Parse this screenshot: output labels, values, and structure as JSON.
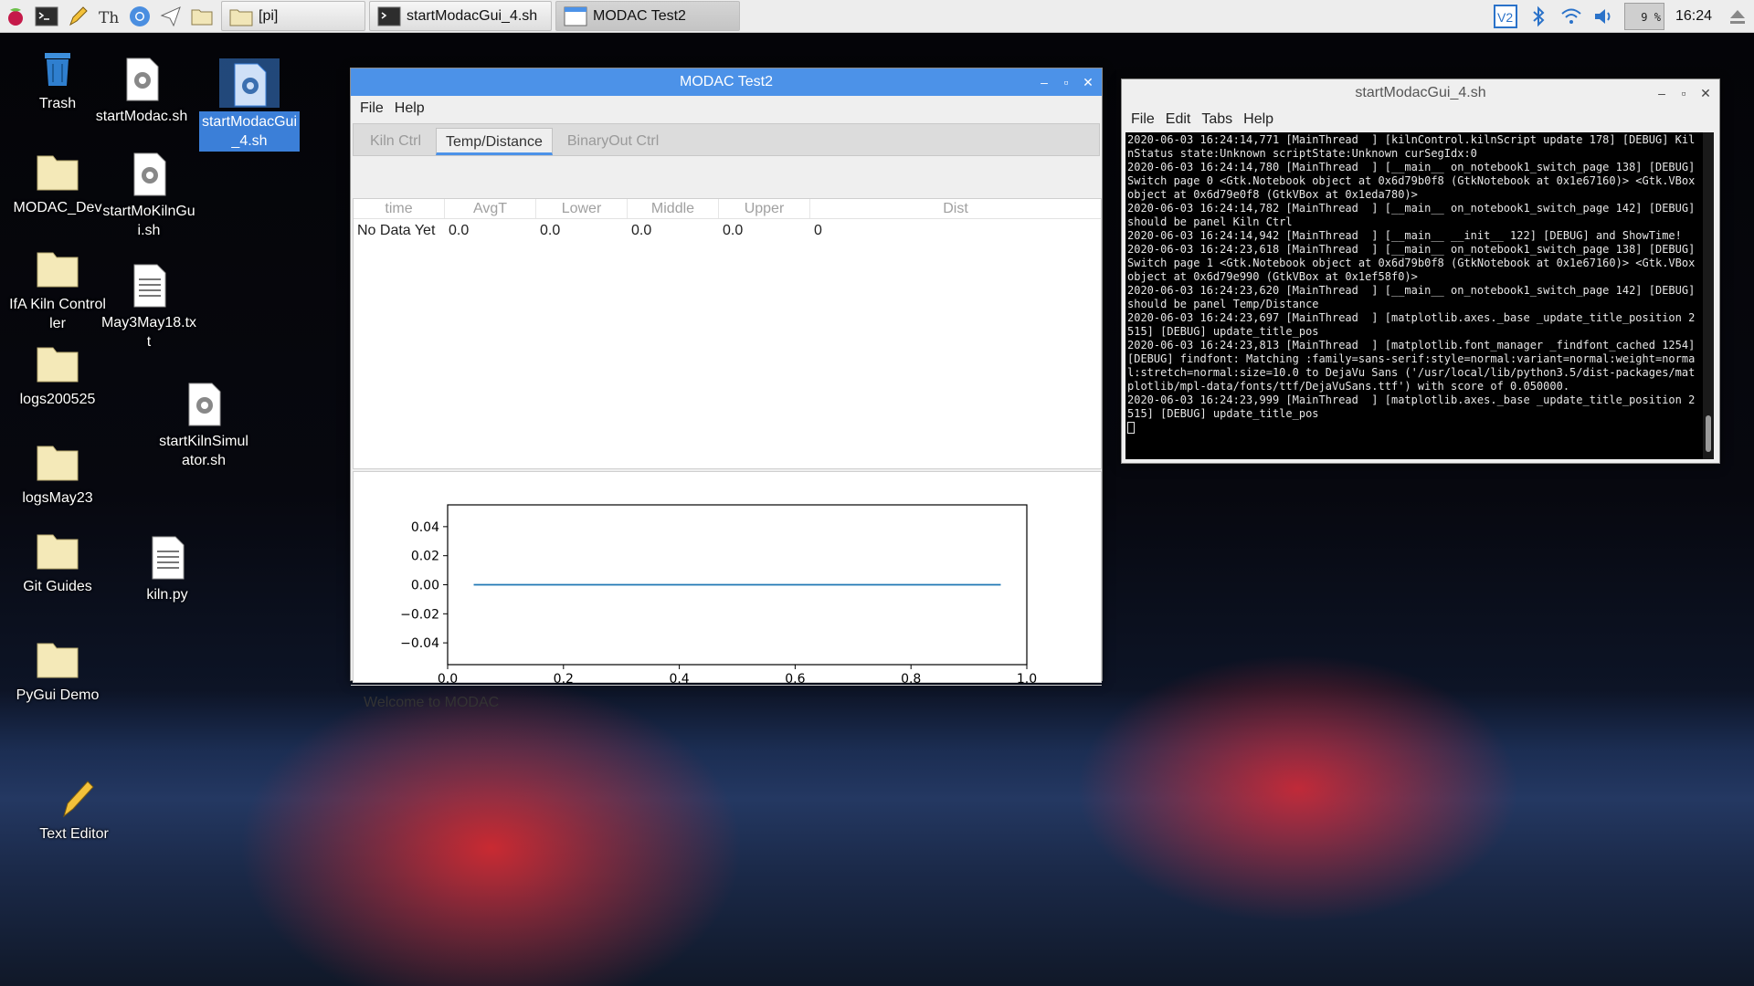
{
  "taskbar": {
    "tasks": [
      {
        "label": "[pi]"
      },
      {
        "label": "startModacGui_4.sh"
      },
      {
        "label": "MODAC Test2"
      }
    ],
    "cpu": "9 %",
    "clock": "16:24"
  },
  "desktop": {
    "icons": [
      {
        "label": "Trash"
      },
      {
        "label": "startModac.sh"
      },
      {
        "label": "startModacGui_4.sh"
      },
      {
        "label": "MODAC_Dev"
      },
      {
        "label": "startMoKilnGui.sh"
      },
      {
        "label": "IfA Kiln Controller"
      },
      {
        "label": "May3May18.txt"
      },
      {
        "label": "logs200525"
      },
      {
        "label": "startKilnSimulator.sh"
      },
      {
        "label": "logsMay23"
      },
      {
        "label": "Git Guides"
      },
      {
        "label": "kiln.py"
      },
      {
        "label": "PyGui Demo"
      },
      {
        "label": "Text Editor"
      }
    ]
  },
  "modac": {
    "title": "MODAC Test2",
    "menu": [
      "File",
      "Help"
    ],
    "tabs": [
      "Kiln Ctrl",
      "Temp/Distance",
      "BinaryOut Ctrl"
    ],
    "columns": [
      "time",
      "AvgT",
      "Lower",
      "Middle",
      "Upper",
      "Dist"
    ],
    "row": [
      "No Data Yet",
      "0.0",
      "0.0",
      "0.0",
      "0.0",
      "0"
    ],
    "status": "Welcome to MODAC"
  },
  "chart_data": {
    "type": "line",
    "title": "",
    "xlabel": "",
    "ylabel": "",
    "xlim": [
      0.0,
      1.0
    ],
    "ylim": [
      -0.055,
      0.055
    ],
    "xticks": [
      "0.0",
      "0.2",
      "0.4",
      "0.6",
      "0.8",
      "1.0"
    ],
    "yticks": [
      "0.04",
      "0.02",
      "0.00",
      "−0.02",
      "−0.04"
    ],
    "ytick_values": [
      0.04,
      0.02,
      0.0,
      -0.02,
      -0.04
    ],
    "xtick_values": [
      0.0,
      0.2,
      0.4,
      0.6,
      0.8,
      1.0
    ],
    "series": [
      {
        "x": [
          0.0,
          1.0
        ],
        "y": [
          0.0,
          0.0
        ],
        "color": "#1f77b4"
      }
    ]
  },
  "terminal": {
    "title": "startModacGui_4.sh",
    "menu": [
      "File",
      "Edit",
      "Tabs",
      "Help"
    ],
    "text": "2020-06-03 16:24:14,771 [MainThread  ] [kilnControl.kilnScript update 178] [DEBUG] KilnStatus state:Unknown scriptState:Unknown curSegIdx:0\n2020-06-03 16:24:14,780 [MainThread  ] [__main__ on_notebook1_switch_page 138] [DEBUG] Switch page 0 <Gtk.Notebook object at 0x6d79b0f8 (GtkNotebook at 0x1e67160)> <Gtk.VBox object at 0x6d79e0f8 (GtkVBox at 0x1eda780)>\n2020-06-03 16:24:14,782 [MainThread  ] [__main__ on_notebook1_switch_page 142] [DEBUG] should be panel Kiln Ctrl\n2020-06-03 16:24:14,942 [MainThread  ] [__main__ __init__ 122] [DEBUG] and ShowTime!\n2020-06-03 16:24:23,618 [MainThread  ] [__main__ on_notebook1_switch_page 138] [DEBUG] Switch page 1 <Gtk.Notebook object at 0x6d79b0f8 (GtkNotebook at 0x1e67160)> <Gtk.VBox object at 0x6d79e990 (GtkVBox at 0x1ef58f0)>\n2020-06-03 16:24:23,620 [MainThread  ] [__main__ on_notebook1_switch_page 142] [DEBUG] should be panel Temp/Distance\n2020-06-03 16:24:23,697 [MainThread  ] [matplotlib.axes._base _update_title_position 2515] [DEBUG] update_title_pos\n2020-06-03 16:24:23,813 [MainThread  ] [matplotlib.font_manager _findfont_cached 1254] [DEBUG] findfont: Matching :family=sans-serif:style=normal:variant=normal:weight=normal:stretch=normal:size=10.0 to DejaVu Sans ('/usr/local/lib/python3.5/dist-packages/matplotlib/mpl-data/fonts/ttf/DejaVuSans.ttf') with score of 0.050000.\n2020-06-03 16:24:23,999 [MainThread  ] [matplotlib.axes._base _update_title_position 2515] [DEBUG] update_title_pos"
  }
}
